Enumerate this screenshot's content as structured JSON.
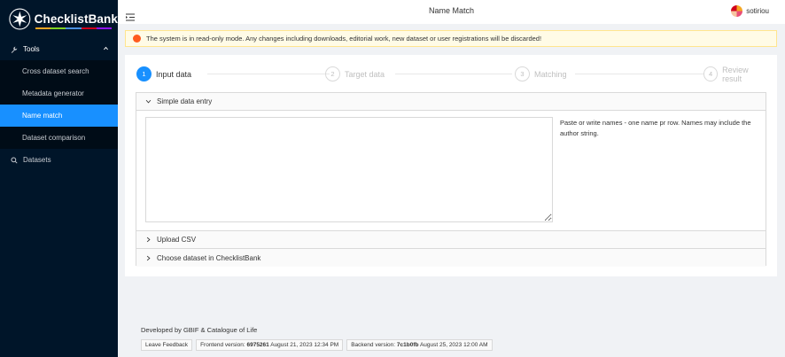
{
  "app": {
    "name": "ChecklistBank",
    "logo_bar_colors": [
      "#f5a623",
      "#7ed321",
      "#4a90e2",
      "#d0021b",
      "#9013fe"
    ]
  },
  "header": {
    "title": "Name Match",
    "user": "sotiriou"
  },
  "sidebar": {
    "group": {
      "label": "Tools",
      "icon": "wrench-icon"
    },
    "items": [
      {
        "label": "Cross dataset search",
        "active": false
      },
      {
        "label": "Metadata generator",
        "active": false
      },
      {
        "label": "Name match",
        "active": true
      },
      {
        "label": "Dataset comparison",
        "active": false
      }
    ],
    "datasets": {
      "label": "Datasets",
      "icon": "search-icon"
    }
  },
  "alert": {
    "text": "The system is in read-only mode. Any changes including downloads, editorial work, new dataset or user registrations will be discarded!",
    "color": "#ff5b1f"
  },
  "steps": [
    {
      "num": "1",
      "title": "Input data",
      "active": true
    },
    {
      "num": "2",
      "title": "Target data",
      "active": false
    },
    {
      "num": "3",
      "title": "Matching",
      "active": false
    },
    {
      "num": "4",
      "title": "Review result",
      "active": false
    }
  ],
  "panels": {
    "simple": {
      "label": "Simple data entry",
      "help": "Paste or write names - one name pr row. Names may include the author string.",
      "textarea_value": ""
    },
    "upload": {
      "label": "Upload CSV"
    },
    "choose": {
      "label": "Choose dataset in ChecklistBank"
    }
  },
  "footer": {
    "developed": "Developed by GBIF & Catalogue of Life",
    "feedback": "Leave Feedback",
    "frontend_label": "Frontend version:",
    "frontend_hash": "6975261",
    "frontend_date": "August 21, 2023 12:34 PM",
    "backend_label": "Backend version:",
    "backend_hash": "7c1b0fb",
    "backend_date": "August 25, 2023 12:00 AM"
  },
  "colors": {
    "primary": "#1890ff",
    "sidebar": "#001529"
  }
}
